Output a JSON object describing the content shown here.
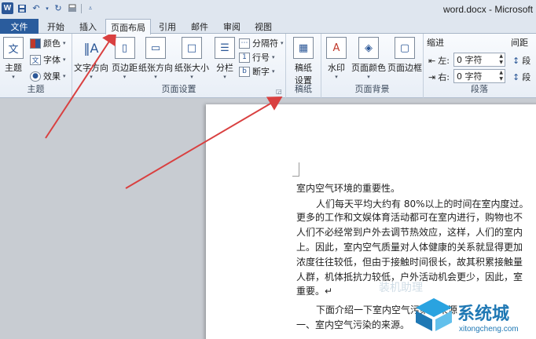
{
  "window": {
    "title": "word.docx - Microsoft"
  },
  "quick_access": {
    "icon": "W",
    "save": "save-icon",
    "undo": "undo-icon",
    "redo": "redo-icon"
  },
  "tabs": [
    {
      "label": "文件"
    },
    {
      "label": "开始"
    },
    {
      "label": "插入"
    },
    {
      "label": "页面布局"
    },
    {
      "label": "引用"
    },
    {
      "label": "邮件"
    },
    {
      "label": "审阅"
    },
    {
      "label": "视图"
    }
  ],
  "ribbon": {
    "theme_group": {
      "label": "主题",
      "theme_button": "主题",
      "colors": "颜色",
      "fonts": "字体",
      "effects": "效果"
    },
    "page_setup_group": {
      "label": "页面设置",
      "text_direction": "文字方向",
      "margins": "页边距",
      "orientation": "纸张方向",
      "size": "纸张大小",
      "columns": "分栏",
      "breaks": "分隔符",
      "line_numbers": "行号",
      "hyphenation": "断字"
    },
    "draft_group": {
      "label": "稿纸",
      "draft_paper": "稿纸",
      "draft_paper_2": "设置"
    },
    "page_background_group": {
      "label": "页面背景",
      "watermark": "水印",
      "page_color": "页面颜色",
      "page_borders": "页面边框"
    },
    "paragraph_group": {
      "label": "段落",
      "indent_title": "缩进",
      "spacing_title": "间距",
      "left_label": "左:",
      "right_label": "右:",
      "left_value": "0 字符",
      "right_value": "0 字符",
      "spacing_before": "段",
      "spacing_after": "段"
    }
  },
  "document": {
    "lines": [
      "室内空气环境的重要性。",
      "人们每天平均大约有 80%以上的时间在室内度过。",
      "更多的工作和文娱体育活动都可在室内进行，购物也不",
      "人们不必经常到户外去调节热效应，这样，人们的室内",
      "上。因此，室内空气质量对人体健康的关系就显得更加",
      "浓度往往较低，但由于接触时间很长，故其积累接触量",
      "人群，机体抵抗力较低，户外活动机会更少，因此，室",
      "重要。↵",
      "下面介绍一下室内空气污染的来源",
      "一、室内空气污染的来源。"
    ]
  },
  "watermark": {
    "text": "系统城",
    "sub": "xitongcheng.com",
    "faded": "装机助理"
  }
}
